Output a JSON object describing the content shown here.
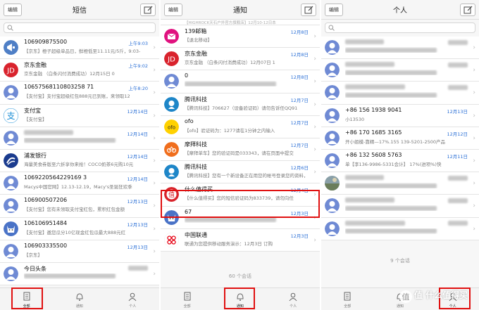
{
  "colors": {
    "accent": "#2a6fd6",
    "highlight": "#e01010",
    "separator": "#e4e4e4",
    "preview": "#7a7a7a"
  },
  "edit_label": "编辑",
  "panel1": {
    "title": "短信",
    "rows": [
      {
        "name": "106909875500",
        "time": "上午9:03",
        "preview": "【京东】橙子超级单品日，鲜橙低至11.11元/5斤，9:03-",
        "avatar": "megaphone-icon"
      },
      {
        "name": "京东金融",
        "time": "上午9:02",
        "preview": "京东金融    （白条闪付消费成功）12月15日 0",
        "avatar": "jd-logo-icon"
      },
      {
        "name": "10657568110803258 71",
        "time": "上午8:20",
        "preview": "【支付宝】支付宝超级红包888元已到账，来领取12",
        "avatar": "person-icon"
      },
      {
        "name": "支付宝",
        "time": "12月14日",
        "preview": "【支付宝】                    ",
        "avatar": "alipay-logo-icon"
      },
      {
        "name": "",
        "time": "12月14日",
        "preview": "",
        "avatar": "person-icon"
      },
      {
        "name": "浦发银行",
        "time": "12月14日",
        "preview": "海量美食券版至六折享你来抢！COCO奶茶6元购10元",
        "avatar": "spdb-logo-icon"
      },
      {
        "name": "1069220564229169 3",
        "time": "12月14日",
        "preview": "Macys中国官网】12.13-12.19，Macy's圣诞狂欢季",
        "avatar": "person-icon"
      },
      {
        "name": "106900507206",
        "time": "12月13日",
        "preview": "【支付宝】您有未领取支付宝红包，累积红包金额",
        "avatar": "person-icon"
      },
      {
        "name": "106106951484",
        "time": "12月13日",
        "preview": "【支付宝】邀您瓜分10亿现金红包瓜最大888元红",
        "avatar": "cat-avatar-icon"
      },
      {
        "name": "106903335500",
        "time": "12月13日",
        "preview": "【京东】                  ",
        "avatar": "person-icon"
      },
      {
        "name": "今日头条",
        "time": "",
        "preview": "",
        "avatar": "person-icon"
      }
    ],
    "tabs": [
      "全部",
      "通知",
      "个人"
    ]
  },
  "panel2": {
    "title": "通知",
    "rows": [
      {
        "name": "",
        "time": "",
        "preview": "【HIGHROCK天石户外官方旗舰店】12月10-12日本",
        "avatar": "person-icon",
        "partial": true
      },
      {
        "name": "139邮箱",
        "time": "12月8日",
        "preview": "【退北移动】",
        "avatar": "mail139-logo-icon"
      },
      {
        "name": "京东金融",
        "time": "12月8日",
        "preview": "京东金融    （白条闪付消费成功）12月07日 1",
        "avatar": "jd-logo-icon"
      },
      {
        "name": "0",
        "time": "12月8日",
        "preview": "",
        "avatar": "person-icon"
      },
      {
        "name": "腾讯科技",
        "time": "12月7日",
        "preview": "【腾讯科技】706627（设备验证码）请勿告诉任QQ91",
        "avatar": "tencent-logo-icon"
      },
      {
        "name": "ofo",
        "time": "12月7日",
        "preview": "【ofo】验证码为：1277请在1分钟之内输入",
        "avatar": "ofo-logo-icon"
      },
      {
        "name": "摩拜科技",
        "time": "12月7日",
        "preview": "【摩拜单车】您的验证码是033343，请在页面中提交",
        "avatar": "mobike-logo-icon"
      },
      {
        "name": "腾讯科技",
        "time": "12月6日",
        "preview": "【腾讯科技】您有一个新设备正在用您的帐号登录您的资料，",
        "avatar": "tencent-logo-icon"
      },
      {
        "name": "什么值得买",
        "time": "12月4日",
        "preview": "【什么值得买】您的短信验证码为833739，请勿向任",
        "avatar": "smzdm-logo-icon"
      },
      {
        "name": "67",
        "time": "12月3日",
        "preview": "",
        "avatar": "cat-avatar-icon"
      },
      {
        "name": "中国联通",
        "time": "12月3日",
        "preview": "联通为您提供移动服务演示：12月3日 订购",
        "avatar": "unicom-logo-icon"
      }
    ],
    "footer": "60 个会话",
    "tabs": [
      "全部",
      "通知",
      "个人"
    ]
  },
  "panel3": {
    "title": "个人",
    "rows": [
      {
        "name": "",
        "time": "",
        "preview": "",
        "avatar": "person-icon"
      },
      {
        "name": "",
        "time": "",
        "preview": "",
        "avatar": "person-icon"
      },
      {
        "name": "",
        "time": "",
        "preview": "",
        "avatar": "person-icon"
      },
      {
        "name": "+86 156 1938 9041",
        "time": "12月13日",
        "preview": "小13530",
        "avatar": "person-icon"
      },
      {
        "name": "+86 170 1685 3165",
        "time": "12月12日",
        "preview": "开小姐模-靠精—17%.155    139-5201-2500产品",
        "avatar": "person-icon"
      },
      {
        "name": "+86 132 5608 5763",
        "time": "12月11日",
        "preview": "单【李136-9986-5331会计】     17%(进项%)快",
        "avatar": "person-icon"
      },
      {
        "name": "",
        "time": "",
        "preview": "",
        "avatar": "photo-avatar-icon"
      },
      {
        "name": "",
        "time": "",
        "preview": "",
        "avatar": "person-icon"
      },
      {
        "name": "",
        "time": "",
        "preview": "",
        "avatar": "person-icon"
      }
    ],
    "footer": "9 个会话",
    "tabs": [
      "全部",
      "通知",
      "个人"
    ]
  },
  "watermark": {
    "title": "值 什么值得买",
    "sub": ""
  }
}
